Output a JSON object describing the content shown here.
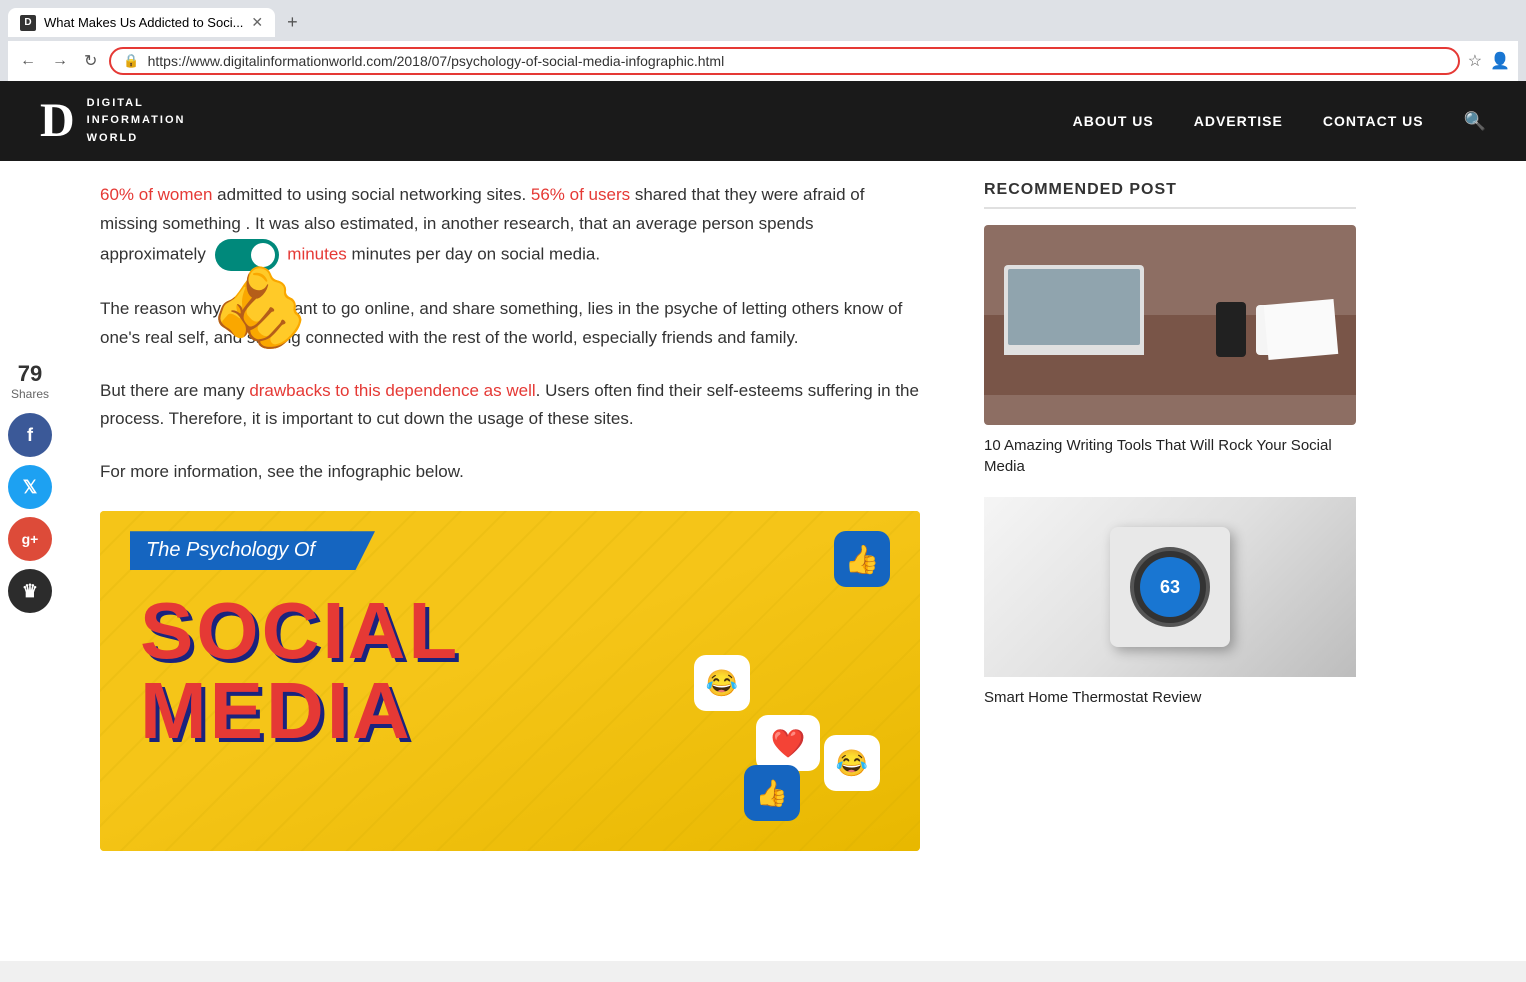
{
  "browser": {
    "tab_title": "What Makes Us Addicted to Soci...",
    "tab_favicon": "D",
    "new_tab_label": "+",
    "url": "https://www.digitalinformationworld.com/2018/07/psychology-of-social-media-infographic.html",
    "nav_back": "←",
    "nav_forward": "→",
    "nav_refresh": "↻",
    "star_label": "☆",
    "user_label": "👤"
  },
  "header": {
    "logo_d": "D",
    "logo_line1": "DIGITAL",
    "logo_line2": "INFORMATION",
    "logo_line3": "WORLD",
    "nav": {
      "about": "ABOUT US",
      "advertise": "ADVERTISE",
      "contact": "CONTACT US"
    }
  },
  "social": {
    "shares_number": "79",
    "shares_label": "Shares",
    "facebook_icon": "f",
    "twitter_icon": "t",
    "google_icon": "g+",
    "crown_icon": "♛"
  },
  "article": {
    "paragraph1_prefix": "60% of women",
    "paragraph1_mid1": " admitted to using social networking sites. ",
    "paragraph1_mid2": "56% of users",
    "paragraph1_mid3": " shared that they were afraid of missing something",
    "paragraph1_toggle": "",
    "paragraph1_suffix": " minutes per day on social media.",
    "paragraph2": "The reason why people want to go online, and share something, lies in the psyche of letting others know of one's real self, and staying connected with the rest of the world, especially friends and family.",
    "paragraph3_prefix": "But there are many ",
    "paragraph3_link": "drawbacks to this dependence as well",
    "paragraph3_suffix": ". Users often find their self-esteems suffering in the process. Therefore, it is important to cut down the usage of these sites.",
    "paragraph4": "For more information, see the infographic below.",
    "infographic_subtitle": "The Psychology Of",
    "infographic_title1": "SOCIAL",
    "infographic_title2": "MEDIA",
    "infographic_banner_text": "The Psychology Of"
  },
  "sidebar": {
    "recommended_title": "RECOMMENDED POST",
    "card1_title": "10 Amazing Writing Tools That Will Rock Your Social Media",
    "card2_title": "Smart Home Thermostat Review"
  },
  "cursor": "👆"
}
